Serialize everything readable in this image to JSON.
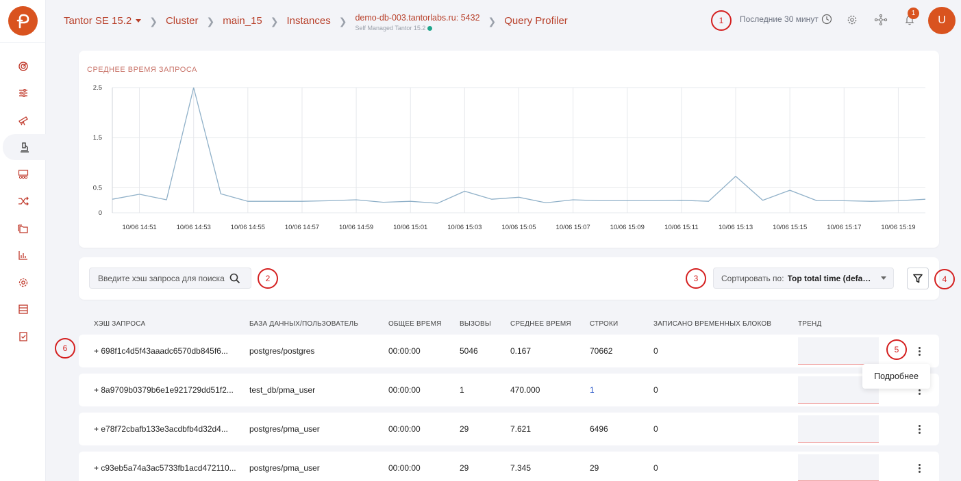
{
  "header": {
    "breadcrumbs": {
      "product": "Tantor SE 15.2",
      "cluster": "Cluster",
      "database": "main_15",
      "instances": "Instances",
      "host": "demo-db-003.tantorlabs.ru: 5432",
      "host_sub": "Self Managed Tantor 15.2",
      "page": "Query Profiler"
    },
    "time_range": "Последние 30 минут",
    "notifications_count": "1",
    "avatar_letter": "U"
  },
  "markers": [
    "1",
    "2",
    "3",
    "4",
    "5",
    "6"
  ],
  "chart_title": "СРЕДНЕЕ ВРЕМЯ ЗАПРОСА",
  "chart_data": {
    "type": "line",
    "title": "СРЕДНЕЕ ВРЕМЯ ЗАПРОСА",
    "ylim": [
      0,
      2.5
    ],
    "y_ticks": [
      "2.5",
      "1.5",
      "0.5",
      "0"
    ],
    "y_tick_values": [
      2.5,
      1.5,
      0.5,
      0
    ],
    "x_ticks": [
      "10/06 14:51",
      "10/06 14:53",
      "10/06 14:55",
      "10/06 14:57",
      "10/06 14:59",
      "10/06 15:01",
      "10/06 15:03",
      "10/06 15:05",
      "10/06 15:07",
      "10/06 15:09",
      "10/06 15:11",
      "10/06 15:13",
      "10/06 15:15",
      "10/06 15:17",
      "10/06 15:19"
    ],
    "series": [
      {
        "color": "#8fb0c8",
        "x": [
          "10/06 14:50",
          "10/06 14:51",
          "10/06 14:52",
          "10/06 14:53",
          "10/06 14:54",
          "10/06 14:55",
          "10/06 14:56",
          "10/06 14:57",
          "10/06 14:58",
          "10/06 14:59",
          "10/06 15:00",
          "10/06 15:01",
          "10/06 15:02",
          "10/06 15:03",
          "10/06 15:04",
          "10/06 15:05",
          "10/06 15:06",
          "10/06 15:07",
          "10/06 15:08",
          "10/06 15:09",
          "10/06 15:10",
          "10/06 15:11",
          "10/06 15:12",
          "10/06 15:13",
          "10/06 15:14",
          "10/06 15:15",
          "10/06 15:16",
          "10/06 15:17",
          "10/06 15:18",
          "10/06 15:19",
          "10/06 15:20"
        ],
        "values": [
          0.27,
          0.37,
          0.26,
          2.5,
          0.38,
          0.23,
          0.23,
          0.23,
          0.24,
          0.26,
          0.21,
          0.23,
          0.19,
          0.43,
          0.27,
          0.31,
          0.2,
          0.26,
          0.24,
          0.24,
          0.24,
          0.25,
          0.23,
          0.73,
          0.25,
          0.45,
          0.24,
          0.24,
          0.23,
          0.24,
          0.27
        ]
      }
    ],
    "grid": true
  },
  "filters": {
    "search_placeholder": "Введите хэш запроса для поиска",
    "sort_label": "Сортировать по:",
    "sort_value": "Top total time (default)"
  },
  "table": {
    "headers": [
      "ХЭШ ЗАПРОСА",
      "БАЗА ДАННЫХ/ПОЛЬЗОВАТЕЛЬ",
      "ОБЩЕЕ ВРЕМЯ",
      "ВЫЗОВЫ",
      "СРЕДНЕЕ ВРЕМЯ",
      "СТРОКИ",
      "ЗАПИСАНО ВРЕМЕННЫХ БЛОКОВ",
      "ТРЕНД"
    ],
    "rows": [
      {
        "hash": "+ 698f1c4d5f43aaadc6570db845f6...",
        "db": "postgres/postgres",
        "total": "00:00:00",
        "calls": "5046",
        "avg": "0.167",
        "rows": "70662",
        "temp": "0"
      },
      {
        "hash": "+ 8a9709b0379b6e1e921729dd51f2...",
        "db": "test_db/pma_user",
        "total": "00:00:00",
        "calls": "1",
        "avg": "470.000",
        "rows": "1",
        "temp": "0"
      },
      {
        "hash": "+ e78f72cbafb133e3acdbfb4d32d4...",
        "db": "postgres/pma_user",
        "total": "00:00:00",
        "calls": "29",
        "avg": "7.621",
        "rows": "6496",
        "temp": "0"
      },
      {
        "hash": "+ c93eb5a74a3ac5733fb1acd472110...",
        "db": "postgres/pma_user",
        "total": "00:00:00",
        "calls": "29",
        "avg": "7.345",
        "rows": "29",
        "temp": "0"
      }
    ]
  },
  "tooltip": "Подробнее"
}
